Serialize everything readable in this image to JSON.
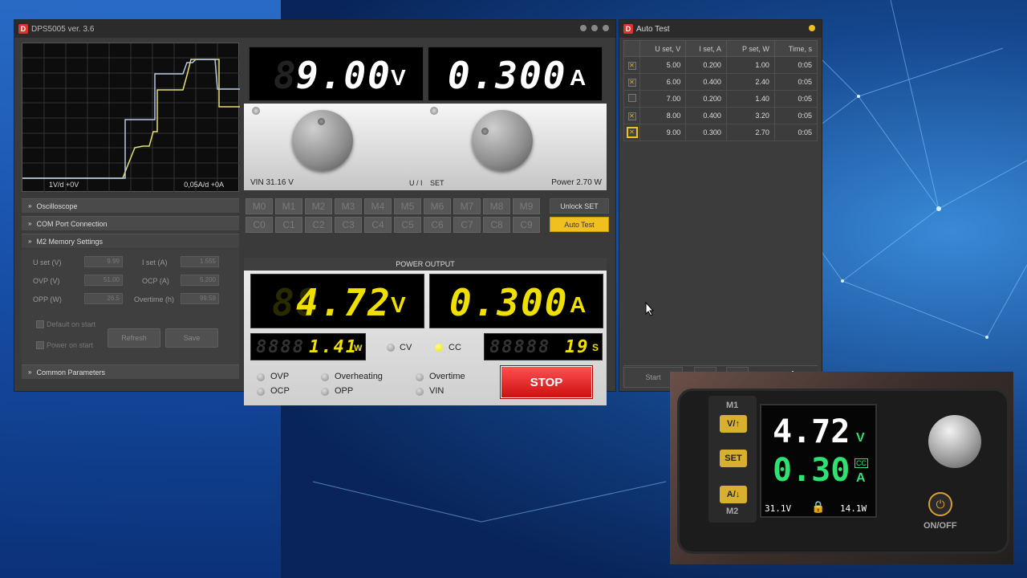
{
  "main_window": {
    "title": "DPS5005 ver. 3.6"
  },
  "scope": {
    "left_label": "1V/d +0V",
    "right_label": "0,05A/d +0A"
  },
  "panels": {
    "oscilloscope": "Oscilloscope",
    "com_port": "COM Port Connection",
    "m2_memory": "M2 Memory Settings",
    "common": "Common Parameters"
  },
  "memory": {
    "u_set_label": "U set (V)",
    "u_set": "9.99",
    "i_set_label": "I set (A)",
    "i_set": "1.555",
    "ovp_label": "OVP (V)",
    "ovp": "51.00",
    "ocp_label": "OCP (A)",
    "ocp": "5.200",
    "opp_label": "OPP  (W)",
    "opp": "26.5",
    "overtime_label": "Overtime (h)",
    "overtime": "99:59",
    "default_on_start": "Default on start",
    "power_on_start": "Power on start",
    "refresh": "Refresh",
    "save": "Save"
  },
  "set_display": {
    "voltage": "9.00",
    "voltage_ghost": "8",
    "voltage_unit": "V",
    "current": "0.300",
    "current_unit": "A"
  },
  "knob_panel": {
    "vin": "VIN 31.16 V",
    "ui": "U / I",
    "set": "SET",
    "power": "Power 2.70 W"
  },
  "memory_buttons_m": [
    "M0",
    "M1",
    "M2",
    "M3",
    "M4",
    "M5",
    "M6",
    "M7",
    "M8",
    "M9"
  ],
  "memory_buttons_c": [
    "C0",
    "C1",
    "C2",
    "C3",
    "C4",
    "C5",
    "C6",
    "C7",
    "C8",
    "C9"
  ],
  "unlock_set": "Unlock SET",
  "auto_test_btn": "Auto Test",
  "output": {
    "header": "POWER OUTPUT",
    "voltage": "4.72",
    "voltage_ghost": "88",
    "voltage_unit": "V",
    "current": "0.300",
    "current_unit": "A",
    "power": "1.41",
    "power_ghost": "8888",
    "power_unit": "W",
    "cv": "CV",
    "cc": "CC",
    "time": "19",
    "time_ghost": "88888",
    "time_unit": "S",
    "stop": "STOP"
  },
  "protections": {
    "ovp": "OVP",
    "ocp": "OCP",
    "overheating": "Overheating",
    "opp": "OPP",
    "overtime": "Overtime",
    "vin": "VIN"
  },
  "auto_test": {
    "title": "Auto Test",
    "columns": [
      "U set, V",
      "I set, A",
      "P set, W",
      "Time, s"
    ],
    "rows": [
      {
        "u": "5.00",
        "i": "0.200",
        "p": "1.00",
        "t": "0:05",
        "checked": true
      },
      {
        "u": "6.00",
        "i": "0.400",
        "p": "2.40",
        "t": "0:05",
        "checked": true
      },
      {
        "u": "7.00",
        "i": "0.200",
        "p": "1.40",
        "t": "0:05",
        "checked": false
      },
      {
        "u": "8.00",
        "i": "0.400",
        "p": "3.20",
        "t": "0:05",
        "checked": true
      },
      {
        "u": "9.00",
        "i": "0.300",
        "p": "2.70",
        "t": "0:05",
        "checked": true
      }
    ],
    "start": "Start",
    "minus": "-",
    "plus": "+"
  },
  "device": {
    "m1": "M1",
    "m2": "M2",
    "v_btn": "V/↑",
    "set_btn": "SET",
    "a_btn": "A/↓",
    "voltage": "4.72",
    "voltage_unit": "V",
    "current": "0.30",
    "current_unit": "A",
    "cc": "CC",
    "vin": "31.1V",
    "power": "14.1W",
    "onoff": "ON/OFF"
  }
}
